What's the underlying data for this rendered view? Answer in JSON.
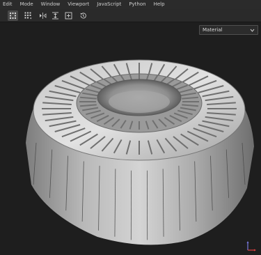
{
  "menu": {
    "items": [
      "Edit",
      "Mode",
      "Window",
      "Viewport",
      "JavaScript",
      "Python",
      "Help"
    ]
  },
  "toolbar": {
    "tools": [
      {
        "icon": "grid-select-icon",
        "active": true
      },
      {
        "icon": "grid-dropdown-icon",
        "active": false
      },
      {
        "icon": "mirror-horizontal-icon",
        "active": false
      },
      {
        "icon": "align-vertical-icon",
        "active": false
      },
      {
        "icon": "frame-add-icon",
        "active": false
      },
      {
        "icon": "history-icon",
        "active": false
      }
    ]
  },
  "viewport": {
    "material_select": {
      "value": "Material"
    },
    "model": {
      "icon": "metal-gear-ring-model"
    },
    "gizmo": {
      "icon": "axis-gizmo-icon",
      "colors": {
        "x": "#e04040",
        "y": "#7a7ae0"
      }
    }
  }
}
